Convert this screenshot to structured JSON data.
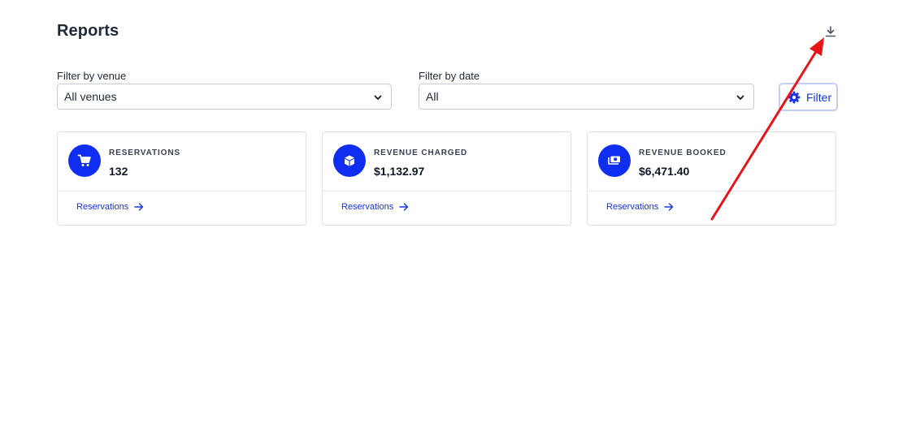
{
  "page": {
    "title": "Reports"
  },
  "header": {
    "download_icon": "download-icon"
  },
  "filters": {
    "venue": {
      "label": "Filter by venue",
      "value": "All venues"
    },
    "date": {
      "label": "Filter by date",
      "value": "All"
    },
    "button_label": "Filter",
    "button_icon": "gear-icon"
  },
  "cards": [
    {
      "label": "RESERVATIONS",
      "value": "132",
      "link": "Reservations",
      "icon": "cart-icon"
    },
    {
      "label": "REVENUE CHARGED",
      "value": "$1,132.97",
      "link": "Reservations",
      "icon": "box-icon"
    },
    {
      "label": "REVENUE BOOKED",
      "value": "$6,471.40",
      "link": "Reservations",
      "icon": "money-icon"
    }
  ],
  "colors": {
    "accent": "#0f2ef0",
    "annotation_arrow": "#e8141a"
  }
}
